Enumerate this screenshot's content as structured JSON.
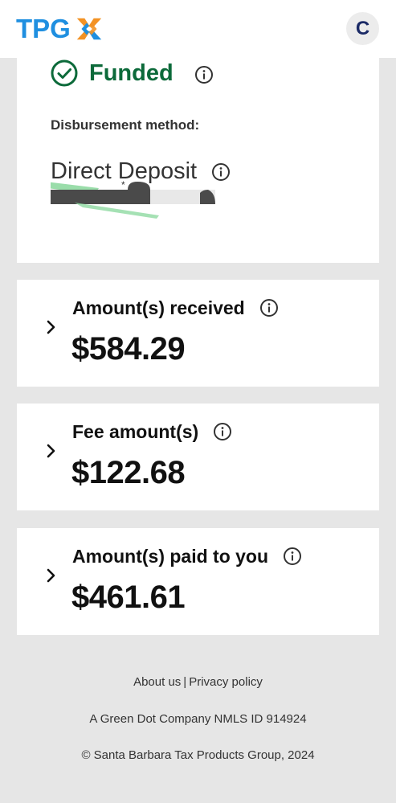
{
  "header": {
    "logo_text": "TPG",
    "logo_mark_colors": [
      "#f39224",
      "#1f8fe0"
    ],
    "avatar_initial": "C"
  },
  "status": {
    "label": "Funded",
    "icon": "check-circle-icon",
    "color": "#0c6a3a",
    "disbursement_label": "Disbursement method:",
    "disbursement_value": "Direct Deposit"
  },
  "cards": [
    {
      "title": "Amount(s) received",
      "amount": "$584.29"
    },
    {
      "title": "Fee amount(s)",
      "amount": "$122.68"
    },
    {
      "title": "Amount(s) paid to you",
      "amount": "$461.61"
    }
  ],
  "footer": {
    "about_link": "About us",
    "separator": "|",
    "privacy_link": "Privacy policy",
    "company_line": "A Green Dot Company NMLS ID 914924",
    "copyright": "© Santa Barbara Tax Products Group, 2024"
  }
}
